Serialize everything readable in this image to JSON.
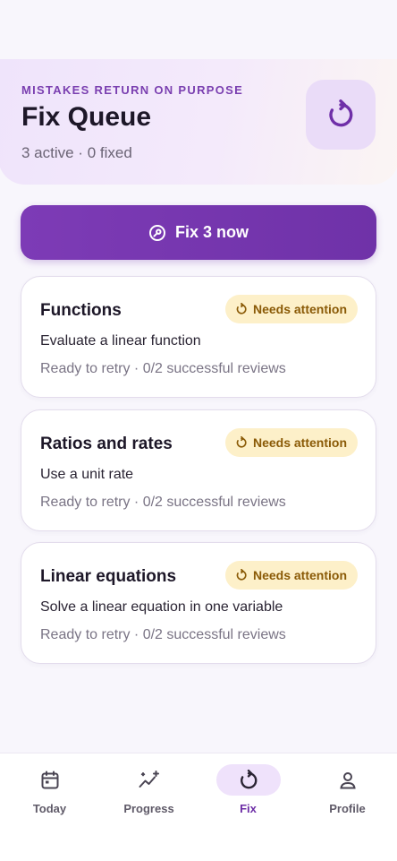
{
  "header": {
    "eyebrow": "MISTAKES RETURN ON PURPOSE",
    "title": "Fix Queue",
    "subtitle": "3 active · 0 fixed",
    "action_icon": "retry-icon"
  },
  "primary_action": {
    "label": "Fix 3 now",
    "icon": "wrench-icon"
  },
  "queue": [
    {
      "topic": "Functions",
      "skill": "Evaluate a linear function",
      "status": "Ready to retry · 0/2 successful reviews",
      "badge": "Needs attention"
    },
    {
      "topic": "Ratios and rates",
      "skill": "Use a unit rate",
      "status": "Ready to retry · 0/2 successful reviews",
      "badge": "Needs attention"
    },
    {
      "topic": "Linear equations",
      "skill": "Solve a linear equation in one variable",
      "status": "Ready to retry · 0/2 successful reviews",
      "badge": "Needs attention"
    }
  ],
  "tabs": [
    {
      "label": "Today",
      "icon": "calendar-icon",
      "active": false
    },
    {
      "label": "Progress",
      "icon": "trend-sparkle-icon",
      "active": false
    },
    {
      "label": "Fix",
      "icon": "retry-icon",
      "active": true
    },
    {
      "label": "Profile",
      "icon": "person-icon",
      "active": false
    }
  ],
  "colors": {
    "accent": "#7534ad",
    "badge_bg": "#fdf0c9",
    "badge_text": "#8a5a06",
    "background": "#f8f6fc"
  }
}
